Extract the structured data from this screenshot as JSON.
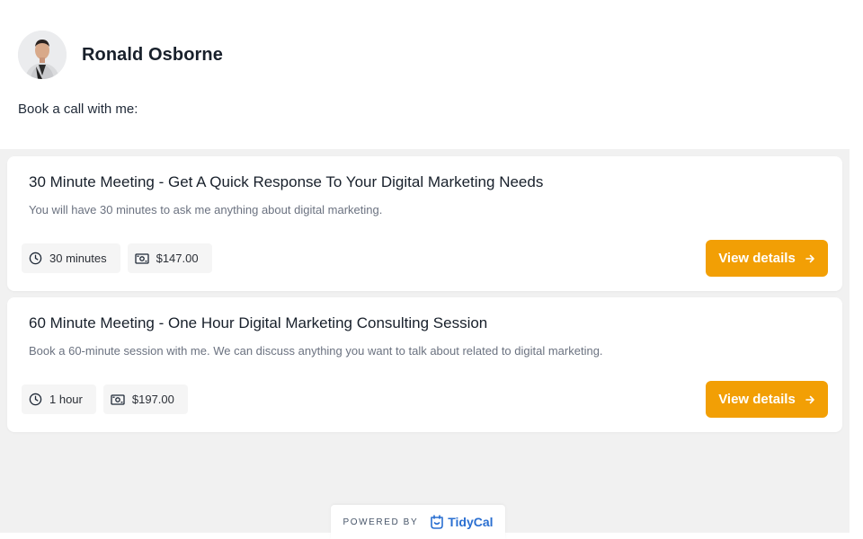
{
  "profile": {
    "name": "Ronald Osborne",
    "intro": "Book a call with me:"
  },
  "meetings": [
    {
      "title": "30 Minute Meeting - Get A Quick Response To Your Digital Marketing Needs",
      "description": "You will have 30 minutes to ask me anything about digital marketing.",
      "duration": "30 minutes",
      "price": "$147.00",
      "button_label": "View details"
    },
    {
      "title": "60 Minute Meeting - One Hour Digital Marketing Consulting Session",
      "description": "Book a 60-minute session with me. We can discuss anything you want to talk about related to digital marketing.",
      "duration": "1 hour",
      "price": "$197.00",
      "button_label": "View details"
    }
  ],
  "footer": {
    "powered_by": "POWERED BY",
    "brand": "TidyCal"
  },
  "colors": {
    "accent": "#f29f05",
    "brand": "#2a6fd1",
    "background": "#f1f1f1"
  },
  "icons": {
    "duration": "clock-icon",
    "price": "money-icon",
    "button": "arrow-right-icon",
    "brand": "tidycal-logo-icon"
  }
}
